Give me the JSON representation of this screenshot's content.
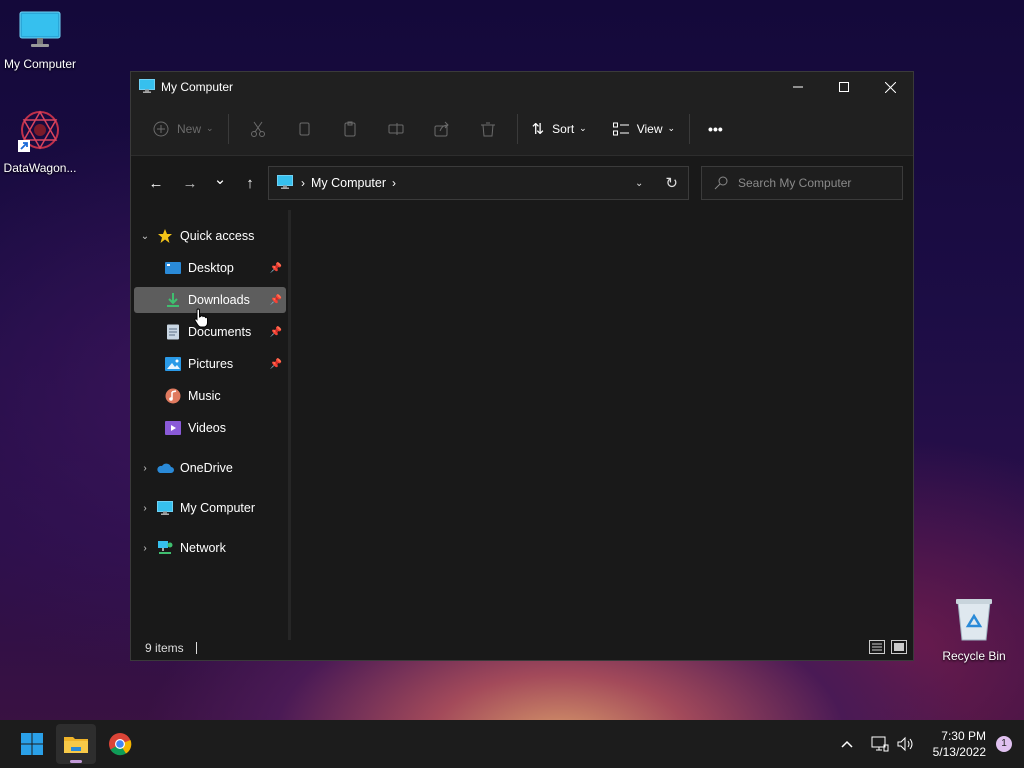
{
  "desktop": {
    "icons": [
      {
        "label": "My Computer",
        "icon": "monitor-icon"
      },
      {
        "label": "DataWagon...",
        "icon": "datawagon-app-icon"
      },
      {
        "label": "Recycle Bin",
        "icon": "recycle-bin-icon"
      }
    ]
  },
  "window": {
    "title": "My Computer",
    "controls": {
      "minimize": "minimize-icon",
      "maximize": "maximize-icon",
      "close": "close-icon"
    }
  },
  "commandbar": {
    "new_label": "New",
    "sort_label": "Sort",
    "view_label": "View",
    "more_label": "•••",
    "disabled_icons": [
      "cut-icon",
      "copy-icon",
      "paste-icon",
      "rename-icon",
      "share-icon",
      "delete-icon"
    ]
  },
  "navigation": {
    "back": "←",
    "forward": "→",
    "recent": "⌄",
    "up": "↑",
    "address": {
      "crumb": "My Computer",
      "separator": "›"
    },
    "refresh": "↻"
  },
  "search": {
    "placeholder": "Search My Computer"
  },
  "sidebar": {
    "quick_access": "Quick access",
    "pinned": [
      {
        "label": "Desktop",
        "icon": "desktop-folder-icon",
        "pinned": true
      },
      {
        "label": "Downloads",
        "icon": "downloads-folder-icon",
        "pinned": true,
        "selected": true
      },
      {
        "label": "Documents",
        "icon": "documents-folder-icon",
        "pinned": true
      },
      {
        "label": "Pictures",
        "icon": "pictures-folder-icon",
        "pinned": true
      },
      {
        "label": "Music",
        "icon": "music-folder-icon",
        "pinned": false
      },
      {
        "label": "Videos",
        "icon": "videos-folder-icon",
        "pinned": false
      }
    ],
    "roots": [
      {
        "label": "OneDrive",
        "icon": "onedrive-cloud-icon"
      },
      {
        "label": "My Computer",
        "icon": "monitor-icon"
      },
      {
        "label": "Network",
        "icon": "network-icon"
      }
    ]
  },
  "status": {
    "items": "9 items"
  },
  "taskbar": {
    "apps": [
      "windows-start-icon",
      "file-explorer-icon",
      "chrome-icon"
    ],
    "clock_time": "7:30 PM",
    "clock_date": "5/13/2022",
    "notifications": "1"
  },
  "colors": {
    "window_bg": "#191919",
    "selected": "#5d5d5d",
    "accent": "#c29ad8"
  }
}
